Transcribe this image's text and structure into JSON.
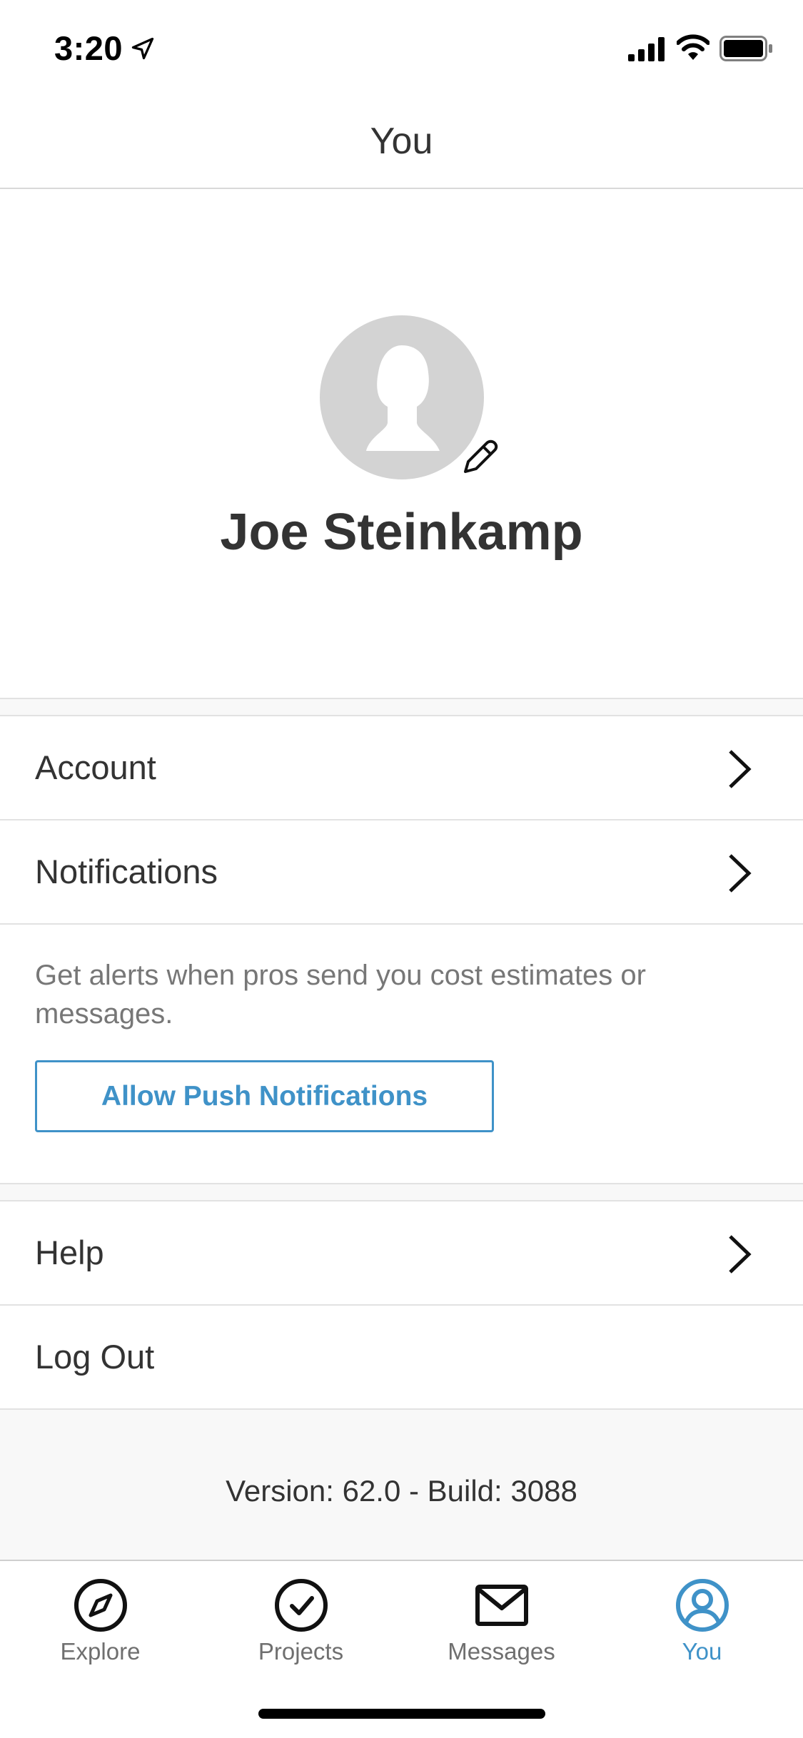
{
  "status_bar": {
    "time": "3:20",
    "icons": [
      "location-arrow-icon",
      "signal-icon",
      "wifi-icon",
      "battery-icon"
    ]
  },
  "header": {
    "title": "You"
  },
  "profile": {
    "name": "Joe Steinkamp",
    "avatar_icon": "avatar-placeholder-icon",
    "edit_icon": "pencil-icon"
  },
  "menu": {
    "account": "Account",
    "notifications": "Notifications",
    "notifications_description": "Get alerts when pros send you cost estimates or messages.",
    "push_button": "Allow Push Notifications",
    "help": "Help",
    "logout": "Log Out"
  },
  "footer": {
    "version": "Version: 62.0 - Build: 3088"
  },
  "tabs": [
    {
      "label": "Explore",
      "icon": "compass-icon",
      "active": false
    },
    {
      "label": "Projects",
      "icon": "check-circle-icon",
      "active": false
    },
    {
      "label": "Messages",
      "icon": "envelope-icon",
      "active": false
    },
    {
      "label": "You",
      "icon": "user-circle-icon",
      "active": true
    }
  ],
  "colors": {
    "accent": "#3f92c8",
    "text": "#333333",
    "muted": "#777777",
    "separator": "#e2e2e2",
    "avatar_bg": "#d3d3d3"
  }
}
